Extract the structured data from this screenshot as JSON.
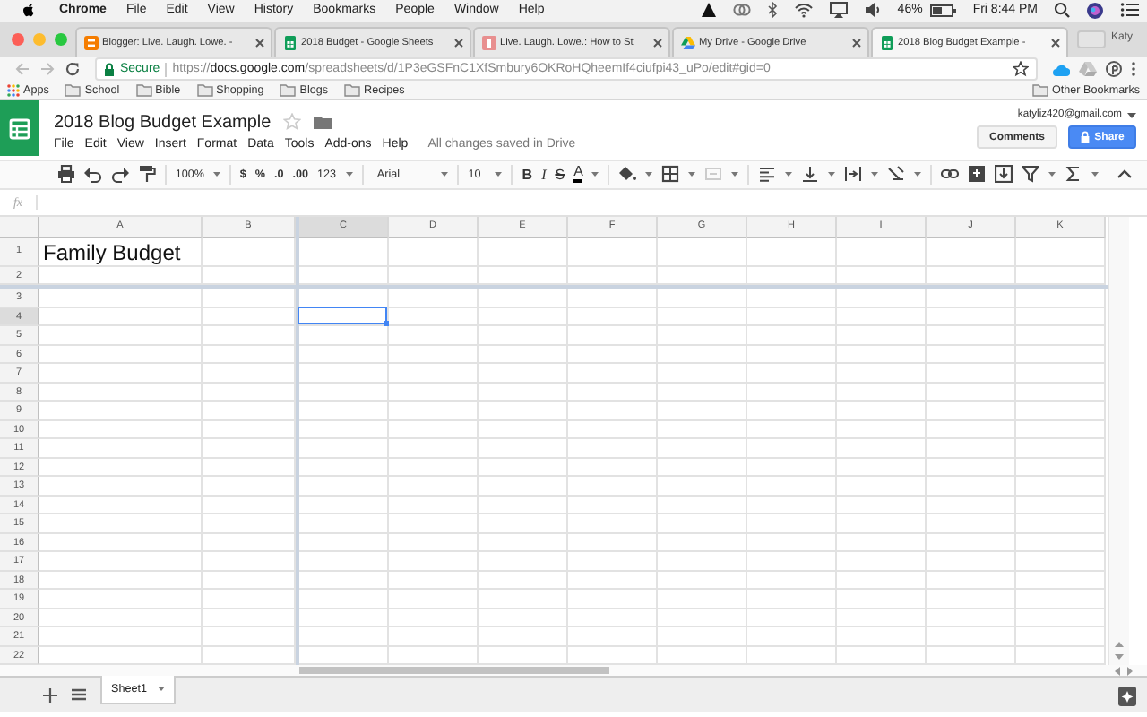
{
  "mac_menubar": {
    "app": "Chrome",
    "items": [
      "File",
      "Edit",
      "View",
      "History",
      "Bookmarks",
      "People",
      "Window",
      "Help"
    ],
    "battery": "46%",
    "clock": "Fri 8:44 PM"
  },
  "browser_tabs": [
    {
      "title": "Blogger: Live. Laugh. Lowe. -",
      "kind": "blogger",
      "selected": false
    },
    {
      "title": "2018 Budget - Google Sheets",
      "kind": "sheets",
      "selected": false
    },
    {
      "title": "Live. Laugh. Lowe.: How to St",
      "kind": "blog",
      "selected": false
    },
    {
      "title": "My Drive - Google Drive",
      "kind": "drive",
      "selected": false
    },
    {
      "title": "2018 Blog Budget Example -",
      "kind": "sheets",
      "selected": true
    }
  ],
  "profile": "Katy",
  "address_bar": {
    "secure": "Secure",
    "scheme": "https://",
    "host": "docs.google.com",
    "path": "/spreadsheets/d/1P3eGSFnC1XfSmbury6OKRoHQheemIf4ciufpi43_uPo/edit#gid=0"
  },
  "bookmarks": [
    "Apps",
    "School",
    "Bible",
    "Shopping",
    "Blogs",
    "Recipes"
  ],
  "other_bookmarks": "Other Bookmarks",
  "document": {
    "title": "2018 Blog Budget Example",
    "starred": false,
    "account": "katyliz420@gmail.com",
    "menu": [
      "File",
      "Edit",
      "View",
      "Insert",
      "Format",
      "Data",
      "Tools",
      "Add-ons",
      "Help"
    ],
    "save_status": "All changes saved in Drive",
    "comments_button": "Comments",
    "share_button": "Share"
  },
  "toolbar": {
    "zoom": "100%",
    "currency": "$",
    "percent": "%",
    "decimal_less": ".0",
    "decimal_more": ".00",
    "number_format": "123",
    "font": "Arial",
    "font_size": "10",
    "bold": "B",
    "italic": "I",
    "strikethrough": "S",
    "text_color": "A"
  },
  "formula_bar": {
    "label": "fx"
  },
  "columns": [
    {
      "label": "A",
      "selected": false
    },
    {
      "label": "B",
      "selected": false
    },
    {
      "label": "C",
      "selected": true
    },
    {
      "label": "D",
      "selected": false
    },
    {
      "label": "E",
      "selected": false
    },
    {
      "label": "F",
      "selected": false
    },
    {
      "label": "G",
      "selected": false
    },
    {
      "label": "H",
      "selected": false
    },
    {
      "label": "I",
      "selected": false
    },
    {
      "label": "J",
      "selected": false
    },
    {
      "label": "K",
      "selected": false
    }
  ],
  "rows": [
    {
      "label": "1",
      "selected": false,
      "cells": [
        "Family Budget"
      ]
    },
    {
      "label": "2",
      "selected": false
    },
    {
      "label": "3",
      "selected": false
    },
    {
      "label": "4",
      "selected": true
    },
    {
      "label": "5",
      "selected": false
    },
    {
      "label": "6",
      "selected": false
    },
    {
      "label": "7",
      "selected": false
    },
    {
      "label": "8",
      "selected": false
    },
    {
      "label": "9",
      "selected": false
    },
    {
      "label": "10",
      "selected": false
    },
    {
      "label": "11",
      "selected": false
    },
    {
      "label": "12",
      "selected": false
    },
    {
      "label": "13",
      "selected": false
    },
    {
      "label": "14",
      "selected": false
    },
    {
      "label": "15",
      "selected": false
    },
    {
      "label": "16",
      "selected": false
    },
    {
      "label": "17",
      "selected": false
    },
    {
      "label": "18",
      "selected": false
    },
    {
      "label": "19",
      "selected": false
    },
    {
      "label": "20",
      "selected": false
    },
    {
      "label": "21",
      "selected": false
    },
    {
      "label": "22",
      "selected": false
    }
  ],
  "sheet_tabs": [
    {
      "label": "Sheet1",
      "selected": true
    }
  ]
}
